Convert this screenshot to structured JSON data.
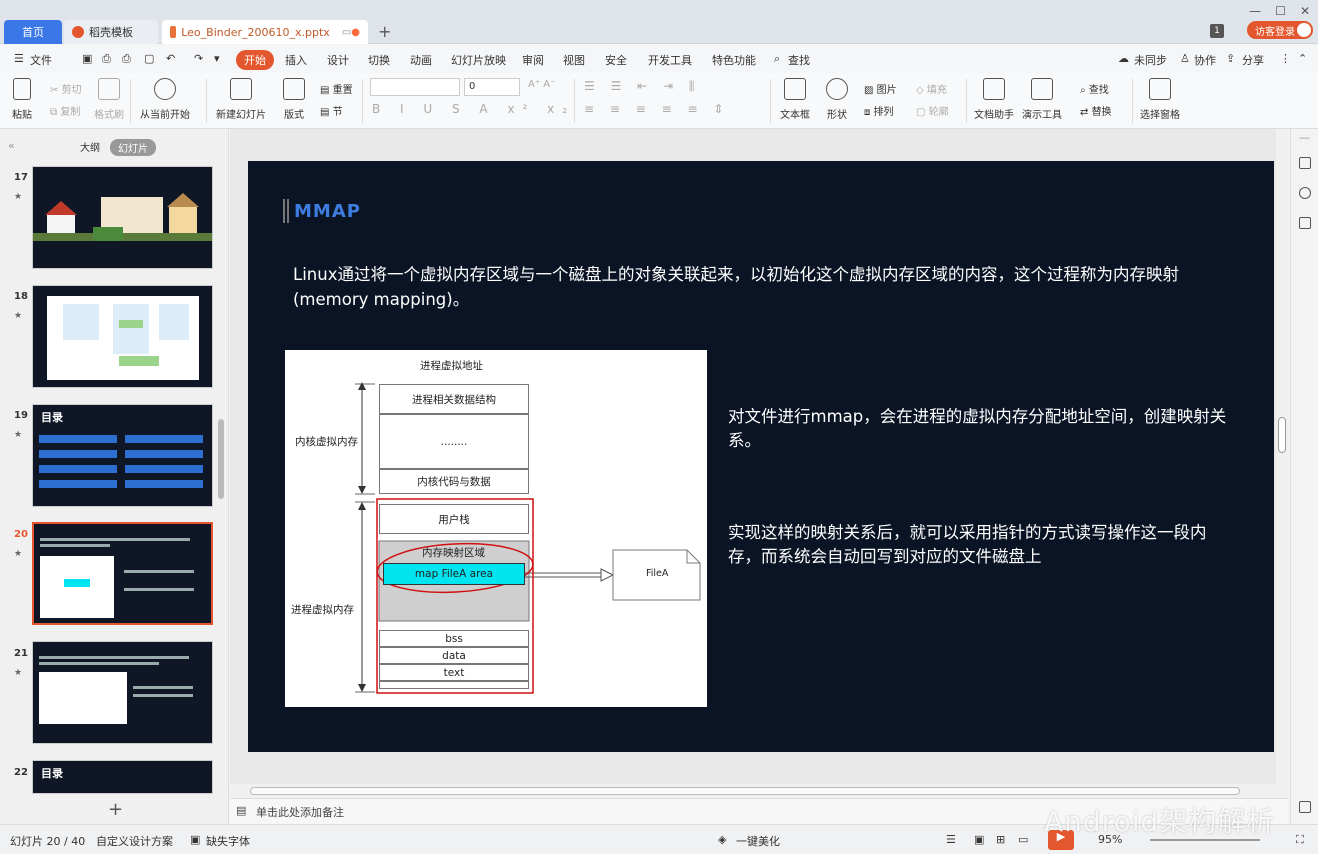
{
  "tabs": {
    "home": "首页",
    "template": "稻壳模板",
    "document": "Leo_Binder_200610_x.pptx"
  },
  "titlebar": {
    "badge": "1",
    "login": "访客登录"
  },
  "menu": {
    "file": "文件",
    "start": "开始",
    "insert": "插入",
    "design": "设计",
    "transition": "切换",
    "animation": "动画",
    "slideshow": "幻灯片放映",
    "review": "审阅",
    "view": "视图",
    "security": "安全",
    "devtools": "开发工具",
    "features": "特色功能",
    "search": "查找",
    "sync": "未同步",
    "collab": "协作",
    "share": "分享"
  },
  "ribbon": {
    "paste": "粘贴",
    "cut": "剪切",
    "copy": "复制",
    "format_painter": "格式刷",
    "play_from_current": "从当前开始",
    "new_slide": "新建幻灯片",
    "layout": "版式",
    "reset": "重置",
    "section": "节",
    "font_size": "0",
    "textbox": "文本框",
    "shape": "形状",
    "picture": "图片",
    "fill": "填充",
    "arrange": "排列",
    "outline": "轮廓",
    "doc_assistant": "文档助手",
    "presentation_tools": "演示工具",
    "find": "查找",
    "replace": "替换",
    "select_pane": "选择窗格"
  },
  "left_panel": {
    "outline_tab": "大纲",
    "slides_tab": "幻灯片",
    "slide_numbers": [
      "17",
      "18",
      "19",
      "20",
      "21",
      "22"
    ],
    "thumb_19_title": "目录",
    "thumb_22_title": "目录",
    "add_slide": "+"
  },
  "slide": {
    "title": "MMAP",
    "paragraph": "Linux通过将一个虚拟内存区域与一个磁盘上的对象关联起来，以初始化这个虚拟内存区域的内容，这个过程称为内存映射(memory mapping)。",
    "right_text_1": "对文件进行mmap，会在进程的虚拟内存分配地址空间，创建映射关系。",
    "right_text_2": "实现这样的映射关系后，就可以采用指针的方式读写操作这一段内存，而系统会自动回写到对应的文件磁盘上"
  },
  "diagram": {
    "header": "进程虚拟地址",
    "kernel_label": "内核虚拟内存",
    "process_label": "进程虚拟内存",
    "box_proc_struct": "进程相关数据结构",
    "box_dots": "........",
    "box_kernel_code": "内核代码与数据",
    "box_user_stack": "用户栈",
    "box_mmap_region": "内存映射区域",
    "box_map_file": "map FileA area",
    "box_bss": "bss",
    "box_data": "data",
    "box_text": "text",
    "file_label": "FileA"
  },
  "notes": {
    "placeholder": "单击此处添加备注"
  },
  "status": {
    "slide_counter": "幻灯片 20 / 40",
    "design_scheme": "自定义设计方案",
    "missing_font": "缺失字体",
    "beautify": "一键美化",
    "zoom": "95%"
  },
  "watermark": "Android架构解析",
  "colors": {
    "accent": "#e4572e",
    "slide_bg": "#0b1424",
    "title_blue": "#3d7de0",
    "highlight_cyan": "#00e5f0",
    "annotation_red": "#d01010"
  }
}
